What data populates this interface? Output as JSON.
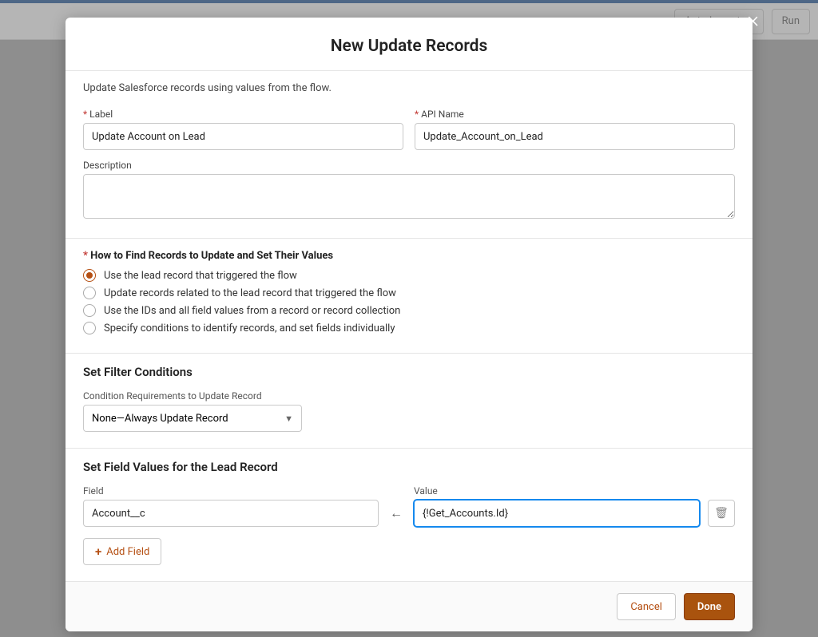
{
  "bg": {
    "auto_layout": "Auto-Layout",
    "run": "Run"
  },
  "modal": {
    "title": "New Update Records",
    "intro": "Update Salesforce records using values from the flow.",
    "label_label": "Label",
    "label_value": "Update Account on Lead",
    "api_label": "API Name",
    "api_value": "Update_Account_on_Lead",
    "description_label": "Description",
    "description_value": "",
    "how_to_find": "How to Find Records to Update and Set Their Values",
    "radios": [
      {
        "label": "Use the lead record that triggered the flow",
        "selected": true
      },
      {
        "label": "Update records related to the lead record that triggered the flow",
        "selected": false
      },
      {
        "label": "Use the IDs and all field values from a record or record collection",
        "selected": false
      },
      {
        "label": "Specify conditions to identify records, and set fields individually",
        "selected": false
      }
    ],
    "filter_title": "Set Filter Conditions",
    "condition_req_label": "Condition Requirements to Update Record",
    "condition_req_value": "None—Always Update Record",
    "set_field_title": "Set Field Values for the Lead Record",
    "field_label": "Field",
    "field_value": "Account__c",
    "value_label": "Value",
    "value_value": "{!Get_Accounts.Id}",
    "add_field": "Add Field",
    "cancel": "Cancel",
    "done": "Done"
  }
}
